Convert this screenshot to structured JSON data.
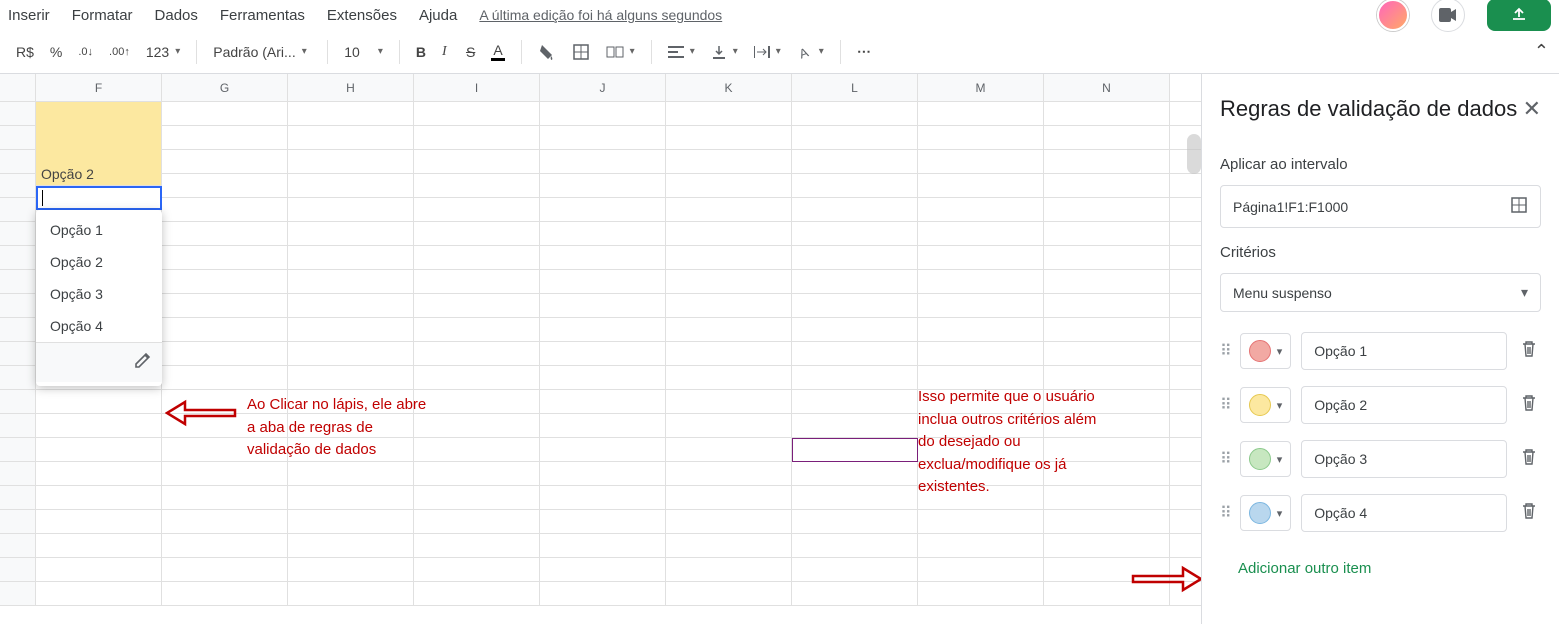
{
  "menu": {
    "items": [
      "Inserir",
      "Formatar",
      "Dados",
      "Ferramentas",
      "Extensões",
      "Ajuda"
    ],
    "edit_info": "A última edição foi há alguns segundos"
  },
  "toolbar": {
    "currency": "R$",
    "percent": "%",
    "dec_less": ".0",
    "dec_more": ".00",
    "num_format": "123",
    "font": "Padrão (Ari...",
    "size": "10",
    "bold": "B",
    "italic": "I",
    "strike": "S",
    "more": "..."
  },
  "columns": [
    "F",
    "G",
    "H",
    "I",
    "J",
    "K",
    "L",
    "M",
    "N"
  ],
  "cell_f1_value": "Opção 2",
  "dropdown": {
    "options": [
      "Opção 1",
      "Opção 2",
      "Opção 3",
      "Opção 4"
    ]
  },
  "annotations": {
    "left": "Ao Clicar no lápis, ele abre a aba de regras de validação de dados",
    "right": "Isso permite que o usuário inclua outros critérios além do desejado ou exclua/modifique os já existentes."
  },
  "panel": {
    "title": "Regras de validação de dados",
    "apply_label": "Aplicar ao intervalo",
    "range": "Página1!F1:F1000",
    "criteria_label": "Critérios",
    "criteria_value": "Menu suspenso",
    "options": [
      {
        "color": "red",
        "label": "Opção 1"
      },
      {
        "color": "yellow",
        "label": "Opção 2"
      },
      {
        "color": "green",
        "label": "Opção 3"
      },
      {
        "color": "blue",
        "label": "Opção 4"
      }
    ],
    "add_item": "Adicionar outro item"
  }
}
